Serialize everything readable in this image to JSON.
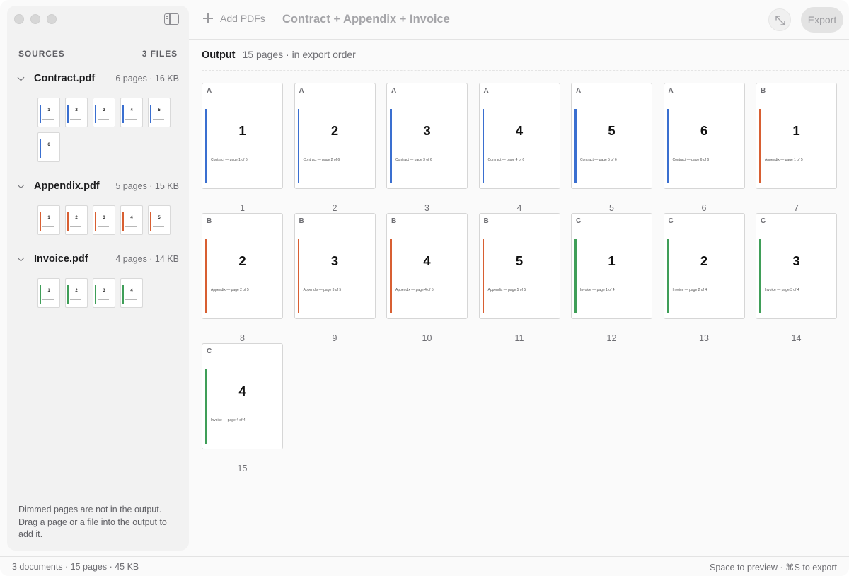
{
  "colors": {
    "A": "#3a6fd0",
    "B": "#d85f32",
    "C": "#3f9e58"
  },
  "toolbar": {
    "add_label": "Add PDFs",
    "title": "Contract + Appendix + Invoice",
    "export_label": "Export"
  },
  "sidebar": {
    "heading": "SOURCES",
    "count": "3 FILES",
    "note": "Dimmed pages are not in the output. Drag a page or a file into the output to add it.",
    "sources": [
      {
        "name": "Contract.pdf",
        "meta": "6 pages · 16 KB",
        "letter": "A",
        "pages": [
          "1",
          "2",
          "3",
          "4",
          "5",
          "6"
        ]
      },
      {
        "name": "Appendix.pdf",
        "meta": "5 pages · 15 KB",
        "letter": "B",
        "pages": [
          "1",
          "2",
          "3",
          "4",
          "5"
        ]
      },
      {
        "name": "Invoice.pdf",
        "meta": "4 pages · 14 KB",
        "letter": "C",
        "pages": [
          "1",
          "2",
          "3",
          "4"
        ]
      }
    ]
  },
  "output": {
    "title": "Output",
    "subtitle": "15 pages · in export order",
    "pages": [
      {
        "letter": "A",
        "num": "1",
        "caption": "Contract — page 1 of 6",
        "index": "1"
      },
      {
        "letter": "A",
        "num": "2",
        "caption": "Contract — page 2 of 6",
        "index": "2"
      },
      {
        "letter": "A",
        "num": "3",
        "caption": "Contract — page 3 of 6",
        "index": "3"
      },
      {
        "letter": "A",
        "num": "4",
        "caption": "Contract — page 4 of 6",
        "index": "4"
      },
      {
        "letter": "A",
        "num": "5",
        "caption": "Contract — page 5 of 6",
        "index": "5"
      },
      {
        "letter": "A",
        "num": "6",
        "caption": "Contract — page 6 of 6",
        "index": "6"
      },
      {
        "letter": "B",
        "num": "1",
        "caption": "Appendix — page 1 of 5",
        "index": "7"
      },
      {
        "letter": "B",
        "num": "2",
        "caption": "Appendix — page 2 of 5",
        "index": "8"
      },
      {
        "letter": "B",
        "num": "3",
        "caption": "Appendix — page 3 of 5",
        "index": "9"
      },
      {
        "letter": "B",
        "num": "4",
        "caption": "Appendix — page 4 of 5",
        "index": "10"
      },
      {
        "letter": "B",
        "num": "5",
        "caption": "Appendix — page 5 of 5",
        "index": "11"
      },
      {
        "letter": "C",
        "num": "1",
        "caption": "Invoice — page 1 of 4",
        "index": "12"
      },
      {
        "letter": "C",
        "num": "2",
        "caption": "Invoice — page 2 of 4",
        "index": "13"
      },
      {
        "letter": "C",
        "num": "3",
        "caption": "Invoice — page 3 of 4",
        "index": "14"
      },
      {
        "letter": "C",
        "num": "4",
        "caption": "Invoice — page 4 of 4",
        "index": "15"
      }
    ]
  },
  "status": {
    "left": "3 documents · 15 pages · 45 KB",
    "right": "Space to preview · ⌘S to export"
  },
  "icons": {
    "sidebar_toggle": "sidebar-toggle-icon",
    "add": "plus-icon",
    "expand": "expand-arrows-icon",
    "disclosure": "chevron-down-icon"
  }
}
